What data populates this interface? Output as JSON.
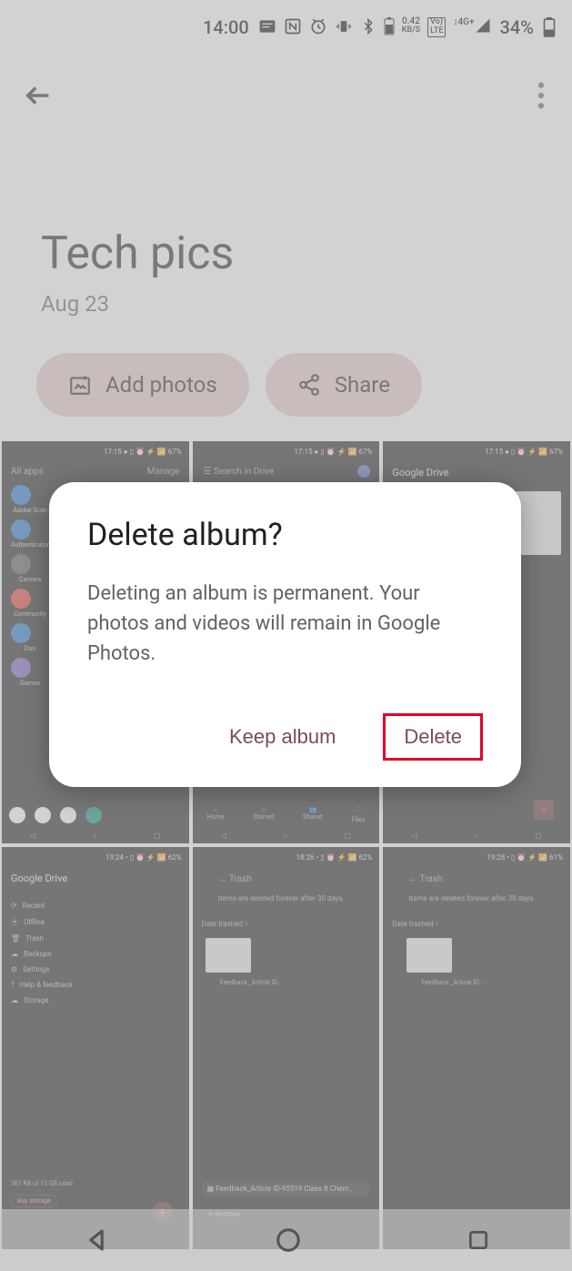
{
  "status": {
    "time": "14:00",
    "data_rate": "0.42 KB/S",
    "network": "4G+",
    "lte": "VoLTE",
    "battery": "34%"
  },
  "album": {
    "title": "Tech pics",
    "date": "Aug 23"
  },
  "actions": {
    "add_photos": "Add photos",
    "share": "Share"
  },
  "dialog": {
    "title": "Delete album?",
    "body": "Deleting an album is permanent. Your photos and videos will remain in Google Photos.",
    "keep": "Keep album",
    "delete": "Delete"
  },
  "thumbs": {
    "time": "17:15",
    "battery": "67%",
    "t2_search": "Search in Drive",
    "t3_title": "Google Drive",
    "grid_a": {
      "time": "19:24",
      "battery": "62%"
    },
    "grid_b": {
      "time": "18:26",
      "battery": "62%"
    },
    "grid_c": {
      "time": "19:28",
      "battery": "61%"
    },
    "trash": "Trash",
    "trash_hint": "Items are deleted forever after 30 days.",
    "date_trashed": "Date trashed ↑",
    "feedback": "Feedback _Article ID-...",
    "restore": "Restore",
    "file_label": "Feedback_Article ID-95519 Class 8 Chem...",
    "allapps": "All apps",
    "manage": "Manage",
    "app_labels": [
      "Adobe Scan",
      "Authenticator",
      "Camera",
      "Community",
      "Duo",
      "Games"
    ],
    "bottom_labels": [
      "Home",
      "Starred",
      "Shared",
      "Files"
    ],
    "drive_menu": [
      "Recent",
      "Offline",
      "Trash",
      "Backups",
      "Settings",
      "Help & feedback",
      "Storage"
    ],
    "storage_text": "361 KB of 15 GB used",
    "buy_storage": "Buy storage"
  }
}
